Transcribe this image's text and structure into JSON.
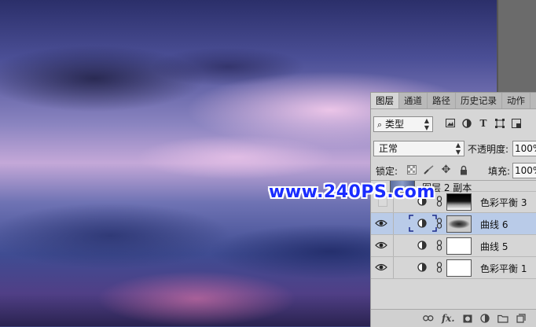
{
  "watermark": "www.240PS.com",
  "panel": {
    "tabs": [
      "图层",
      "通道",
      "路径",
      "历史记录",
      "动作"
    ],
    "filter_kind": "类型",
    "blend_mode": "正常",
    "opacity_label": "不透明度:",
    "opacity_value": "100%",
    "lock_label": "锁定:",
    "fill_label": "填充:",
    "fill_value": "100%",
    "layers": [
      {
        "name": "图层 2 副本",
        "visible": false,
        "kind": "image"
      },
      {
        "name": "色彩平衡 3",
        "visible": false,
        "kind": "adjustment",
        "mask": "dark"
      },
      {
        "name": "曲线 6",
        "visible": true,
        "kind": "adjustment",
        "mask": "gray",
        "selected": true
      },
      {
        "name": "曲线 5",
        "visible": true,
        "kind": "adjustment",
        "mask": "white"
      },
      {
        "name": "色彩平衡 1",
        "visible": true,
        "kind": "adjustment",
        "mask": "white"
      }
    ],
    "bottom_icons": [
      "link-icon",
      "fx-icon",
      "mask-icon",
      "adjustment-icon",
      "folder-icon",
      "new-layer-icon"
    ],
    "filter_icons": [
      "image-filter-icon",
      "adjustment-filter-icon",
      "type-filter-icon",
      "shape-filter-icon",
      "smart-object-filter-icon"
    ],
    "lock_icons": [
      "lock-transparent-icon",
      "lock-image-icon",
      "lock-position-icon",
      "lock-all-icon"
    ]
  }
}
